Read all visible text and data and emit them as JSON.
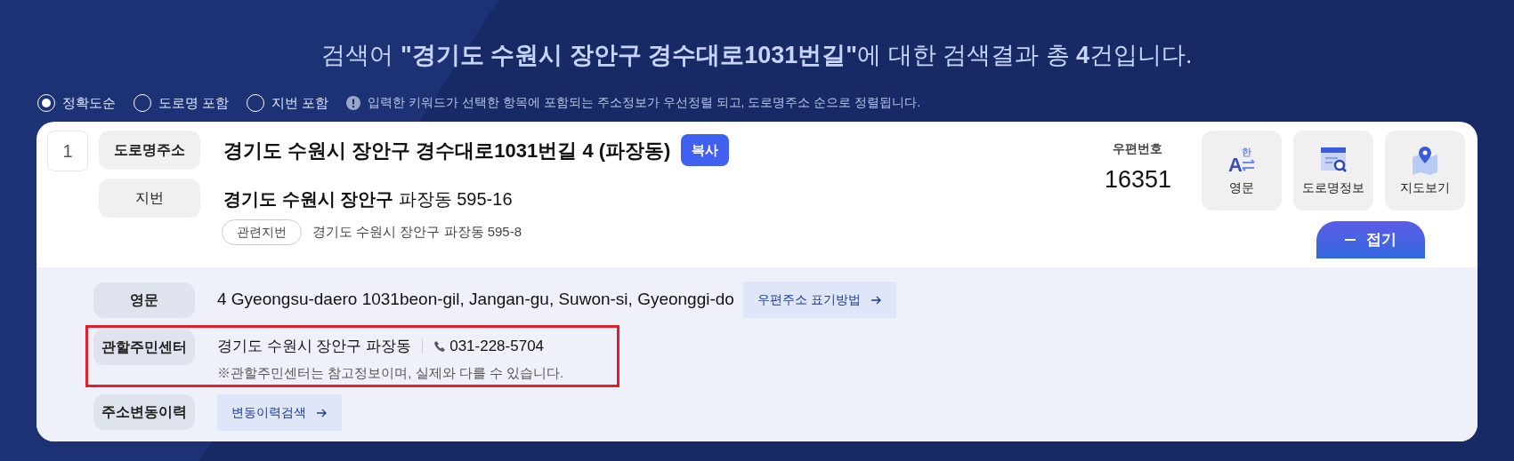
{
  "headline": "검색어 **\"경기도 수원시 장안구 경수대로1031번길\"**에 대한 검색결과 총 **4**건입니다.",
  "filters": [
    {
      "label": "정확도순",
      "selected": true
    },
    {
      "label": "도로명 포함",
      "selected": false
    },
    {
      "label": "지번 포함",
      "selected": false
    }
  ],
  "filter_note": "입력한 키워드가 선택한 항목에 포함되는 주소정보가 우선정렬 되고, 도로명주소 순으로 정렬됩니다.",
  "result": {
    "number": "1",
    "road_label": "도로명주소",
    "road_address": "경기도 수원시 장안구 경수대로1031번길 4 (파장동)",
    "copy_button": "복사",
    "jibun_label": "지번",
    "jibun_address": "**경기도 수원시 장안구** 파장동 595-16",
    "related_tag": "관련지번",
    "related_address": "경기도 수원시 장안구 파장동 595-8",
    "postal_label": "우편번호",
    "postal_code": "16351",
    "actions": [
      {
        "kind": "english",
        "label": "영문",
        "icon_letter": "A",
        "icon_hangul": "한"
      },
      {
        "kind": "road-info",
        "label": "도로명정보"
      },
      {
        "kind": "map",
        "label": "지도보기"
      }
    ],
    "fold_button": "접기",
    "expanded": true,
    "details": [
      {
        "kind": "english",
        "label": "영문",
        "value": "4 Gyeongsu-daero 1031beon-gil, Jangan-gu, Suwon-si, Gyeonggi-do",
        "link": "우편주소 표기방법",
        "highlighted": false
      },
      {
        "kind": "center",
        "label": "관할주민센터",
        "value": "경기도 수원시 장안구 파장동",
        "phone": "031-228-5704",
        "note": "※관할주민센터는 참고정보이며, 실제와 다를 수 있습니다.",
        "highlighted": true
      },
      {
        "kind": "history",
        "label": "주소변동이력",
        "link": "변동이력검색",
        "highlighted": false
      }
    ]
  }
}
